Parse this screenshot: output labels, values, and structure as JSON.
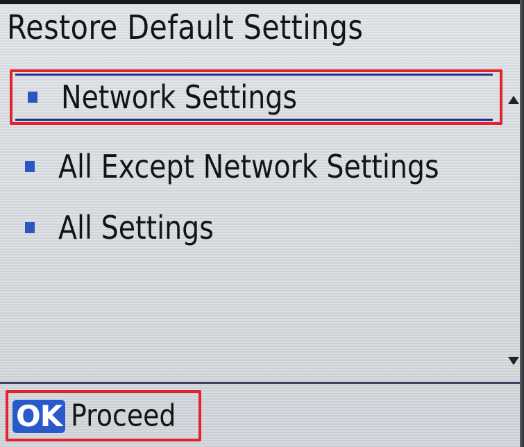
{
  "screen": {
    "title": "Restore Default Settings"
  },
  "menu": {
    "items": [
      {
        "label": "Network Settings",
        "selected": true
      },
      {
        "label": "All Except Network Settings",
        "selected": false
      },
      {
        "label": "All Settings",
        "selected": false
      }
    ]
  },
  "footer": {
    "ok_label": "OK",
    "action_label": "Proceed"
  },
  "colors": {
    "highlight_border": "#e3232b",
    "bullet": "#2a56c4",
    "ok_badge": "#2a59c9"
  },
  "icons": {
    "scroll_up": "triangle-up-icon",
    "scroll_down": "triangle-down-icon",
    "bullet": "square-bullet-icon"
  }
}
